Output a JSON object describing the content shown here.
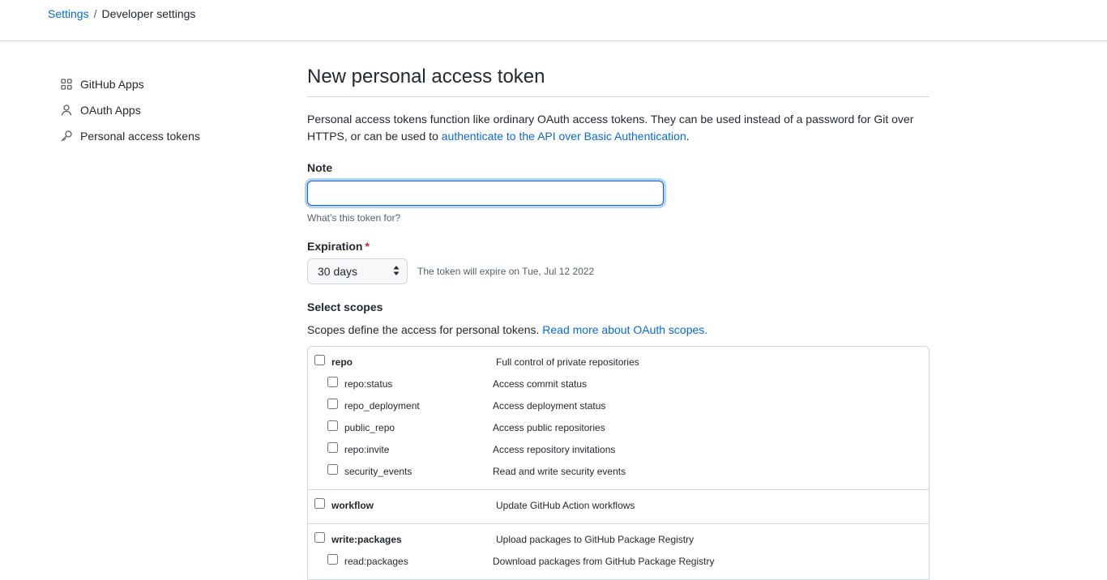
{
  "breadcrumb": {
    "parent": "Settings",
    "separator": "/",
    "current": "Developer settings"
  },
  "sidebar": {
    "items": [
      {
        "label": "GitHub Apps",
        "icon": "apps-grid-icon"
      },
      {
        "label": "OAuth Apps",
        "icon": "person-icon"
      },
      {
        "label": "Personal access tokens",
        "icon": "key-icon"
      }
    ]
  },
  "main": {
    "title": "New personal access token",
    "intro_text": "Personal access tokens function like ordinary OAuth access tokens. They can be used instead of a password for Git over HTTPS, or can be used to ",
    "intro_link": "authenticate to the API over Basic Authentication",
    "intro_end": ".",
    "note": {
      "label": "Note",
      "value": "",
      "hint": "What’s this token for?"
    },
    "expiration": {
      "label": "Expiration",
      "required_mark": "*",
      "selected": "30 days",
      "note": "The token will expire on Tue, Jul 12 2022"
    },
    "scopes": {
      "label": "Select scopes",
      "desc_text": "Scopes define the access for personal tokens. ",
      "desc_link": "Read more about OAuth scopes.",
      "groups": [
        {
          "name": "repo",
          "desc": "Full control of private repositories",
          "children": [
            {
              "name": "repo:status",
              "desc": "Access commit status"
            },
            {
              "name": "repo_deployment",
              "desc": "Access deployment status"
            },
            {
              "name": "public_repo",
              "desc": "Access public repositories"
            },
            {
              "name": "repo:invite",
              "desc": "Access repository invitations"
            },
            {
              "name": "security_events",
              "desc": "Read and write security events"
            }
          ]
        },
        {
          "name": "workflow",
          "desc": "Update GitHub Action workflows",
          "children": []
        },
        {
          "name": "write:packages",
          "desc": "Upload packages to GitHub Package Registry",
          "children": [
            {
              "name": "read:packages",
              "desc": "Download packages from GitHub Package Registry"
            }
          ]
        }
      ]
    }
  },
  "colors": {
    "link": "#0969da",
    "text": "#24292f",
    "muted": "#57606a",
    "border": "#d0d7de",
    "required": "#cf222e"
  }
}
